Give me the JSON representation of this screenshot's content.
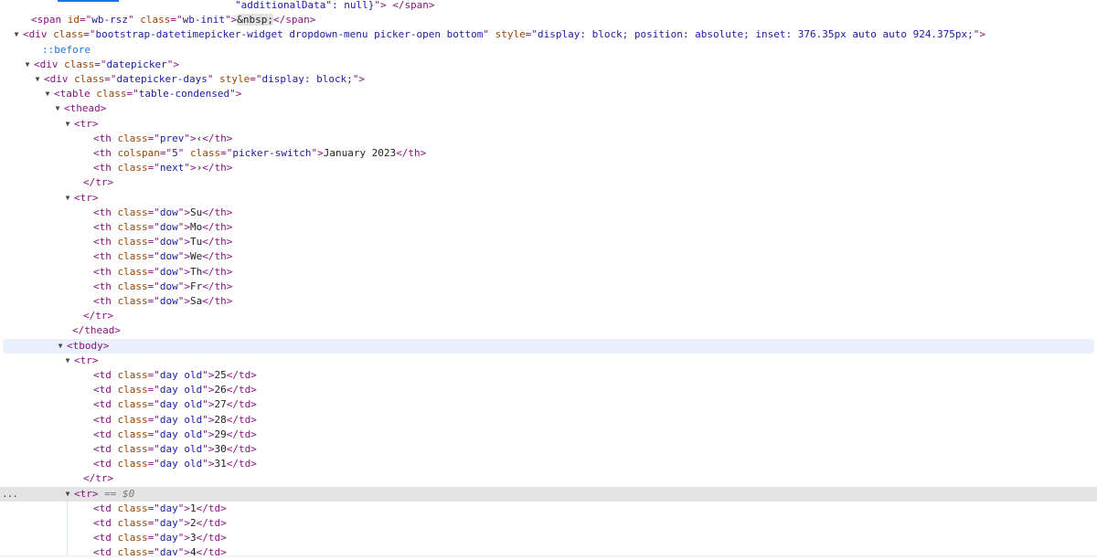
{
  "theme": {
    "tag": "#881280",
    "attr": "#994500",
    "value": "#1a1aa6",
    "text": "#1f1f1f",
    "entity": "#1f1f1f",
    "entityBg": "#e3e3e3",
    "pseudo": "#1a73e8",
    "selectedVar": "#7a7a7a",
    "hoverBg": "#e9f0fb",
    "selectedBg": "#e3e3e3"
  },
  "elements_tree": {
    "rows": [
      {
        "toggle": "",
        "tokens": [
          {
            "t": "\"additionalData\": null}\"> </span>",
            "c": "mixed_end"
          }
        ]
      },
      {
        "toggle": "",
        "tokens": [
          {
            "t": "<span ",
            "c": "tag"
          },
          {
            "t": "id",
            "c": "attr"
          },
          {
            "t": "=\"",
            "c": "tag"
          },
          {
            "t": "wb-rsz",
            "c": "value"
          },
          {
            "t": "\" ",
            "c": "tag"
          },
          {
            "t": "class",
            "c": "attr"
          },
          {
            "t": "=\"",
            "c": "tag"
          },
          {
            "t": "wb-init",
            "c": "value"
          },
          {
            "t": "\">",
            "c": "tag"
          },
          {
            "t": "&nbsp;",
            "c": "entity"
          },
          {
            "t": "</span>",
            "c": "tag"
          }
        ]
      },
      {
        "toggle": "▼",
        "tokens": [
          {
            "t": "<div ",
            "c": "tag"
          },
          {
            "t": "class",
            "c": "attr"
          },
          {
            "t": "=\"",
            "c": "tag"
          },
          {
            "t": "bootstrap-datetimepicker-widget dropdown-menu picker-open bottom",
            "c": "value"
          },
          {
            "t": "\" ",
            "c": "tag"
          },
          {
            "t": "style",
            "c": "attr"
          },
          {
            "t": "=\"",
            "c": "tag"
          },
          {
            "t": "display: block; position: absolute; inset: 376.35px auto auto 924.375px;",
            "c": "value"
          },
          {
            "t": "\">",
            "c": "tag"
          }
        ]
      },
      {
        "toggle": "",
        "tokens": [
          {
            "t": "::before",
            "c": "pseudo"
          }
        ]
      },
      {
        "toggle": "▼",
        "tokens": [
          {
            "t": "<div ",
            "c": "tag"
          },
          {
            "t": "class",
            "c": "attr"
          },
          {
            "t": "=\"",
            "c": "tag"
          },
          {
            "t": "datepicker",
            "c": "value"
          },
          {
            "t": "\">",
            "c": "tag"
          }
        ]
      },
      {
        "toggle": "▼",
        "tokens": [
          {
            "t": "<div ",
            "c": "tag"
          },
          {
            "t": "class",
            "c": "attr"
          },
          {
            "t": "=\"",
            "c": "tag"
          },
          {
            "t": "datepicker-days",
            "c": "value"
          },
          {
            "t": "\" ",
            "c": "tag"
          },
          {
            "t": "style",
            "c": "attr"
          },
          {
            "t": "=\"",
            "c": "tag"
          },
          {
            "t": "display: block;",
            "c": "value"
          },
          {
            "t": "\">",
            "c": "tag"
          }
        ]
      },
      {
        "toggle": "▼",
        "tokens": [
          {
            "t": "<table ",
            "c": "tag"
          },
          {
            "t": "class",
            "c": "attr"
          },
          {
            "t": "=\"",
            "c": "tag"
          },
          {
            "t": "table-condensed",
            "c": "value"
          },
          {
            "t": "\">",
            "c": "tag"
          }
        ]
      },
      {
        "toggle": "▼",
        "tokens": [
          {
            "t": "<thead>",
            "c": "tag"
          }
        ]
      },
      {
        "toggle": "▼",
        "tokens": [
          {
            "t": "<tr>",
            "c": "tag"
          }
        ]
      },
      {
        "toggle": "",
        "tokens": [
          {
            "t": "<th ",
            "c": "tag"
          },
          {
            "t": "class",
            "c": "attr"
          },
          {
            "t": "=\"",
            "c": "tag"
          },
          {
            "t": "prev",
            "c": "value"
          },
          {
            "t": "\">",
            "c": "tag"
          },
          {
            "t": "‹",
            "c": "text"
          },
          {
            "t": "</th>",
            "c": "tag"
          }
        ]
      },
      {
        "toggle": "",
        "tokens": [
          {
            "t": "<th ",
            "c": "tag"
          },
          {
            "t": "colspan",
            "c": "attr"
          },
          {
            "t": "=\"",
            "c": "tag"
          },
          {
            "t": "5",
            "c": "value"
          },
          {
            "t": "\" ",
            "c": "tag"
          },
          {
            "t": "class",
            "c": "attr"
          },
          {
            "t": "=\"",
            "c": "tag"
          },
          {
            "t": "picker-switch",
            "c": "value"
          },
          {
            "t": "\">",
            "c": "tag"
          },
          {
            "t": "January 2023",
            "c": "text"
          },
          {
            "t": "</th>",
            "c": "tag"
          }
        ]
      },
      {
        "toggle": "",
        "tokens": [
          {
            "t": "<th ",
            "c": "tag"
          },
          {
            "t": "class",
            "c": "attr"
          },
          {
            "t": "=\"",
            "c": "tag"
          },
          {
            "t": "next",
            "c": "value"
          },
          {
            "t": "\">",
            "c": "tag"
          },
          {
            "t": "›",
            "c": "text"
          },
          {
            "t": "</th>",
            "c": "tag"
          }
        ]
      },
      {
        "toggle": "",
        "tokens": [
          {
            "t": "</tr>",
            "c": "tag"
          }
        ]
      },
      {
        "toggle": "▼",
        "tokens": [
          {
            "t": "<tr>",
            "c": "tag"
          }
        ]
      },
      {
        "toggle": "",
        "tokens": [
          {
            "t": "<th ",
            "c": "tag"
          },
          {
            "t": "class",
            "c": "attr"
          },
          {
            "t": "=\"",
            "c": "tag"
          },
          {
            "t": "dow",
            "c": "value"
          },
          {
            "t": "\">",
            "c": "tag"
          },
          {
            "t": "Su",
            "c": "text"
          },
          {
            "t": "</th>",
            "c": "tag"
          }
        ]
      },
      {
        "toggle": "",
        "tokens": [
          {
            "t": "<th ",
            "c": "tag"
          },
          {
            "t": "class",
            "c": "attr"
          },
          {
            "t": "=\"",
            "c": "tag"
          },
          {
            "t": "dow",
            "c": "value"
          },
          {
            "t": "\">",
            "c": "tag"
          },
          {
            "t": "Mo",
            "c": "text"
          },
          {
            "t": "</th>",
            "c": "tag"
          }
        ]
      },
      {
        "toggle": "",
        "tokens": [
          {
            "t": "<th ",
            "c": "tag"
          },
          {
            "t": "class",
            "c": "attr"
          },
          {
            "t": "=\"",
            "c": "tag"
          },
          {
            "t": "dow",
            "c": "value"
          },
          {
            "t": "\">",
            "c": "tag"
          },
          {
            "t": "Tu",
            "c": "text"
          },
          {
            "t": "</th>",
            "c": "tag"
          }
        ]
      },
      {
        "toggle": "",
        "tokens": [
          {
            "t": "<th ",
            "c": "tag"
          },
          {
            "t": "class",
            "c": "attr"
          },
          {
            "t": "=\"",
            "c": "tag"
          },
          {
            "t": "dow",
            "c": "value"
          },
          {
            "t": "\">",
            "c": "tag"
          },
          {
            "t": "We",
            "c": "text"
          },
          {
            "t": "</th>",
            "c": "tag"
          }
        ]
      },
      {
        "toggle": "",
        "tokens": [
          {
            "t": "<th ",
            "c": "tag"
          },
          {
            "t": "class",
            "c": "attr"
          },
          {
            "t": "=\"",
            "c": "tag"
          },
          {
            "t": "dow",
            "c": "value"
          },
          {
            "t": "\">",
            "c": "tag"
          },
          {
            "t": "Th",
            "c": "text"
          },
          {
            "t": "</th>",
            "c": "tag"
          }
        ]
      },
      {
        "toggle": "",
        "tokens": [
          {
            "t": "<th ",
            "c": "tag"
          },
          {
            "t": "class",
            "c": "attr"
          },
          {
            "t": "=\"",
            "c": "tag"
          },
          {
            "t": "dow",
            "c": "value"
          },
          {
            "t": "\">",
            "c": "tag"
          },
          {
            "t": "Fr",
            "c": "text"
          },
          {
            "t": "</th>",
            "c": "tag"
          }
        ]
      },
      {
        "toggle": "",
        "tokens": [
          {
            "t": "<th ",
            "c": "tag"
          },
          {
            "t": "class",
            "c": "attr"
          },
          {
            "t": "=\"",
            "c": "tag"
          },
          {
            "t": "dow",
            "c": "value"
          },
          {
            "t": "\">",
            "c": "tag"
          },
          {
            "t": "Sa",
            "c": "text"
          },
          {
            "t": "</th>",
            "c": "tag"
          }
        ]
      },
      {
        "toggle": "",
        "tokens": [
          {
            "t": "</tr>",
            "c": "tag"
          }
        ]
      },
      {
        "toggle": "",
        "tokens": [
          {
            "t": "</thead>",
            "c": "tag"
          }
        ]
      },
      {
        "toggle": "▼",
        "state": "hover",
        "tokens": [
          {
            "t": "<tbody>",
            "c": "tag"
          }
        ]
      },
      {
        "toggle": "▼",
        "tokens": [
          {
            "t": "<tr>",
            "c": "tag"
          }
        ]
      },
      {
        "toggle": "",
        "tokens": [
          {
            "t": "<td ",
            "c": "tag"
          },
          {
            "t": "class",
            "c": "attr"
          },
          {
            "t": "=\"",
            "c": "tag"
          },
          {
            "t": "day old",
            "c": "value"
          },
          {
            "t": "\">",
            "c": "tag"
          },
          {
            "t": "25",
            "c": "text"
          },
          {
            "t": "</td>",
            "c": "tag"
          }
        ]
      },
      {
        "toggle": "",
        "tokens": [
          {
            "t": "<td ",
            "c": "tag"
          },
          {
            "t": "class",
            "c": "attr"
          },
          {
            "t": "=\"",
            "c": "tag"
          },
          {
            "t": "day old",
            "c": "value"
          },
          {
            "t": "\">",
            "c": "tag"
          },
          {
            "t": "26",
            "c": "text"
          },
          {
            "t": "</td>",
            "c": "tag"
          }
        ]
      },
      {
        "toggle": "",
        "tokens": [
          {
            "t": "<td ",
            "c": "tag"
          },
          {
            "t": "class",
            "c": "attr"
          },
          {
            "t": "=\"",
            "c": "tag"
          },
          {
            "t": "day old",
            "c": "value"
          },
          {
            "t": "\">",
            "c": "tag"
          },
          {
            "t": "27",
            "c": "text"
          },
          {
            "t": "</td>",
            "c": "tag"
          }
        ]
      },
      {
        "toggle": "",
        "tokens": [
          {
            "t": "<td ",
            "c": "tag"
          },
          {
            "t": "class",
            "c": "attr"
          },
          {
            "t": "=\"",
            "c": "tag"
          },
          {
            "t": "day old",
            "c": "value"
          },
          {
            "t": "\">",
            "c": "tag"
          },
          {
            "t": "28",
            "c": "text"
          },
          {
            "t": "</td>",
            "c": "tag"
          }
        ]
      },
      {
        "toggle": "",
        "tokens": [
          {
            "t": "<td ",
            "c": "tag"
          },
          {
            "t": "class",
            "c": "attr"
          },
          {
            "t": "=\"",
            "c": "tag"
          },
          {
            "t": "day old",
            "c": "value"
          },
          {
            "t": "\">",
            "c": "tag"
          },
          {
            "t": "29",
            "c": "text"
          },
          {
            "t": "</td>",
            "c": "tag"
          }
        ]
      },
      {
        "toggle": "",
        "tokens": [
          {
            "t": "<td ",
            "c": "tag"
          },
          {
            "t": "class",
            "c": "attr"
          },
          {
            "t": "=\"",
            "c": "tag"
          },
          {
            "t": "day old",
            "c": "value"
          },
          {
            "t": "\">",
            "c": "tag"
          },
          {
            "t": "30",
            "c": "text"
          },
          {
            "t": "</td>",
            "c": "tag"
          }
        ]
      },
      {
        "toggle": "",
        "tokens": [
          {
            "t": "<td ",
            "c": "tag"
          },
          {
            "t": "class",
            "c": "attr"
          },
          {
            "t": "=\"",
            "c": "tag"
          },
          {
            "t": "day old",
            "c": "value"
          },
          {
            "t": "\">",
            "c": "tag"
          },
          {
            "t": "31",
            "c": "text"
          },
          {
            "t": "</td>",
            "c": "tag"
          }
        ]
      },
      {
        "toggle": "",
        "tokens": [
          {
            "t": "</tr>",
            "c": "tag"
          }
        ]
      },
      {
        "toggle": "▼",
        "state": "selected",
        "ellipsis": "...",
        "tokens": [
          {
            "t": "<tr>",
            "c": "tag"
          },
          {
            "t": " == $0",
            "c": "selected_var"
          }
        ]
      },
      {
        "toggle": "",
        "tokens": [
          {
            "t": "<td ",
            "c": "tag"
          },
          {
            "t": "class",
            "c": "attr"
          },
          {
            "t": "=\"",
            "c": "tag"
          },
          {
            "t": "day",
            "c": "value"
          },
          {
            "t": "\">",
            "c": "tag"
          },
          {
            "t": "1",
            "c": "text"
          },
          {
            "t": "</td>",
            "c": "tag"
          }
        ]
      },
      {
        "toggle": "",
        "tokens": [
          {
            "t": "<td ",
            "c": "tag"
          },
          {
            "t": "class",
            "c": "attr"
          },
          {
            "t": "=\"",
            "c": "tag"
          },
          {
            "t": "day",
            "c": "value"
          },
          {
            "t": "\">",
            "c": "tag"
          },
          {
            "t": "2",
            "c": "text"
          },
          {
            "t": "</td>",
            "c": "tag"
          }
        ]
      },
      {
        "toggle": "",
        "tokens": [
          {
            "t": "<td ",
            "c": "tag"
          },
          {
            "t": "class",
            "c": "attr"
          },
          {
            "t": "=\"",
            "c": "tag"
          },
          {
            "t": "day",
            "c": "value"
          },
          {
            "t": "\">",
            "c": "tag"
          },
          {
            "t": "3",
            "c": "text"
          },
          {
            "t": "</td>",
            "c": "tag"
          }
        ]
      },
      {
        "toggle": "",
        "tokens": [
          {
            "t": "<td ",
            "c": "tag"
          },
          {
            "t": "class",
            "c": "attr"
          },
          {
            "t": "=\"",
            "c": "tag"
          },
          {
            "t": "day",
            "c": "value"
          },
          {
            "t": "\">",
            "c": "tag"
          },
          {
            "t": "4",
            "c": "text"
          },
          {
            "t": "</td>",
            "c": "tag"
          }
        ]
      }
    ]
  }
}
